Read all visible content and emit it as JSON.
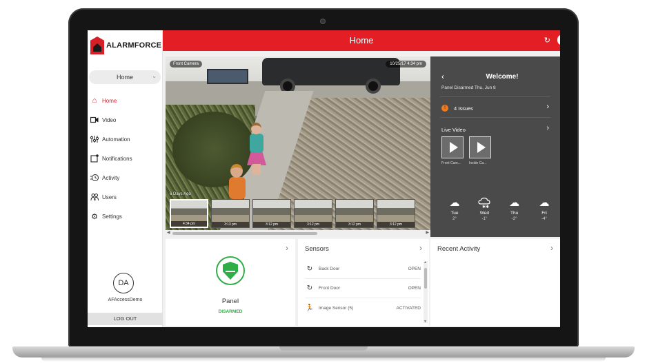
{
  "app": {
    "brand": "ALARMFORCE",
    "page_title": "Home"
  },
  "sidebar": {
    "location_select": "Home",
    "items": [
      {
        "label": "Home",
        "icon": "home-icon",
        "active": true
      },
      {
        "label": "Video",
        "icon": "video-camera-icon",
        "active": false
      },
      {
        "label": "Automation",
        "icon": "sliders-icon",
        "active": false
      },
      {
        "label": "Notifications",
        "icon": "notification-icon",
        "active": false
      },
      {
        "label": "Activity",
        "icon": "activity-icon",
        "active": false
      },
      {
        "label": "Users",
        "icon": "users-icon",
        "active": false
      },
      {
        "label": "Settings",
        "icon": "gear-icon",
        "active": false
      }
    ],
    "user_initials": "DA",
    "user_name": "AFAccessDemo",
    "logout_label": "LOG OUT"
  },
  "video": {
    "camera_label": "Front Camera",
    "timestamp": "10/25/17 4:34 pm",
    "strip_label": "6 Days Ago",
    "thumbnails": [
      "4:34 pm",
      "3:13 pm",
      "3:12 pm",
      "3:12 pm",
      "3:12 pm",
      "3:12 pm"
    ]
  },
  "welcome": {
    "title": "Welcome!",
    "subtitle": "Panel Disarmed Thu, Jun 8",
    "issues_count": "!",
    "issues_label": "4 Issues",
    "live_video_label": "Live Video",
    "cameras": [
      "Front Cam...",
      "Inside Ca..."
    ],
    "forecast": [
      {
        "day": "Tue",
        "temp": "2°",
        "icon": "cloud-icon"
      },
      {
        "day": "Wed",
        "temp": "-1°",
        "icon": "snow-cloud-icon"
      },
      {
        "day": "Thu",
        "temp": "-2°",
        "icon": "cloud-icon"
      },
      {
        "day": "Fri",
        "temp": "-4°",
        "icon": "cloud-icon"
      }
    ]
  },
  "panel_card": {
    "name": "Panel",
    "status": "DISARMED",
    "status_color": "#2fae48"
  },
  "sensors_card": {
    "title": "Sensors",
    "rows": [
      {
        "name": "Back Door",
        "status": "OPEN"
      },
      {
        "name": "Front Door",
        "status": "OPEN"
      },
      {
        "name": "Image Sensor (5)",
        "status": "ACTIVATED"
      }
    ]
  },
  "activity_card": {
    "title": "Recent Activity"
  },
  "colors": {
    "brand_red": "#e31e24",
    "panel_dark": "#4a4a4a",
    "ok_green": "#2fae48",
    "issue_orange": "#f07a1e"
  }
}
